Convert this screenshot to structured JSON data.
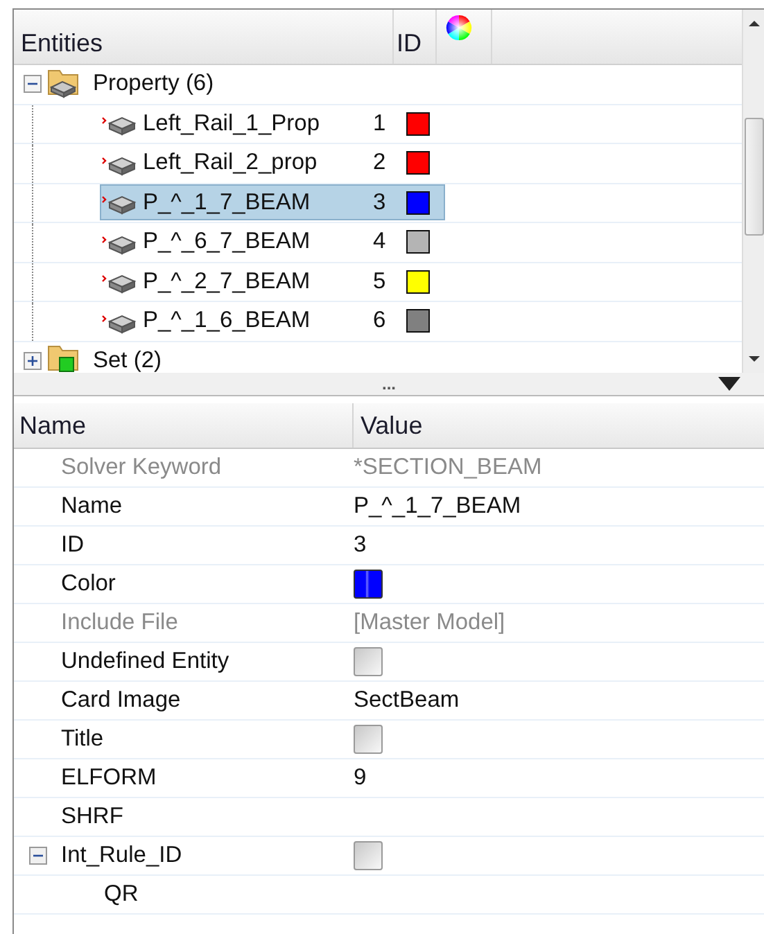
{
  "entities": {
    "columns": [
      "Entities",
      "ID"
    ],
    "tree": [
      {
        "kind": "folder",
        "label": "Property (6)",
        "expanded": true,
        "children": [
          {
            "label": "Left_Rail_1_Prop",
            "id": "1",
            "color": "#ff0000",
            "selected": false
          },
          {
            "label": "Left_Rail_2_prop",
            "id": "2",
            "color": "#ff0000",
            "selected": false
          },
          {
            "label": "P_^_1_7_BEAM",
            "id": "3",
            "color": "#0000ff",
            "selected": true
          },
          {
            "label": "P_^_6_7_BEAM",
            "id": "4",
            "color": "#b4b4b4",
            "selected": false
          },
          {
            "label": "P_^_2_7_BEAM",
            "id": "5",
            "color": "#ffff00",
            "selected": false
          },
          {
            "label": "P_^_1_6_BEAM",
            "id": "6",
            "color": "#808080",
            "selected": false
          }
        ]
      },
      {
        "kind": "set",
        "label": "Set (2)",
        "expanded": false
      }
    ],
    "splitter": "..."
  },
  "properties": {
    "columns": [
      "Name",
      "Value"
    ],
    "rows": [
      {
        "kind": "text",
        "name": "Solver Keyword",
        "value": "*SECTION_BEAM",
        "disabled": true
      },
      {
        "kind": "text",
        "name": "Name",
        "value": "P_^_1_7_BEAM",
        "disabled": false
      },
      {
        "kind": "text",
        "name": "ID",
        "value": "3",
        "disabled": false
      },
      {
        "kind": "color",
        "name": "Color",
        "color": "#0000ff",
        "disabled": false
      },
      {
        "kind": "text",
        "name": "Include File",
        "value": "[Master Model]",
        "disabled": true
      },
      {
        "kind": "checkbox",
        "name": "Undefined Entity",
        "checked": false,
        "disabled": false
      },
      {
        "kind": "text",
        "name": "Card Image",
        "value": "SectBeam",
        "disabled": false
      },
      {
        "kind": "checkbox",
        "name": "Title",
        "checked": false,
        "disabled": false
      },
      {
        "kind": "text",
        "name": "ELFORM",
        "value": "9",
        "disabled": false
      },
      {
        "name": "SHRF",
        "disabled": false
      },
      {
        "kind": "checkbox",
        "name": "Int_Rule_ID",
        "checked": false,
        "disabled": false,
        "expanded": true,
        "children": [
          {
            "name": "QR",
            "disabled": false
          }
        ]
      }
    ]
  }
}
